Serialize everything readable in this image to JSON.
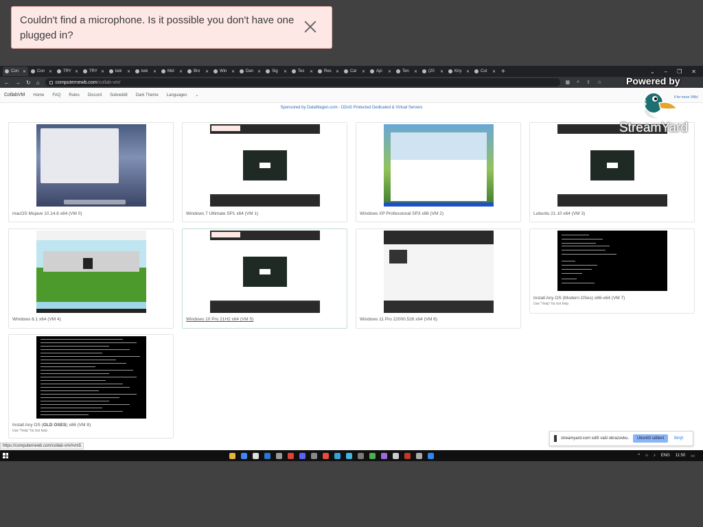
{
  "toast": {
    "message": "Couldn't find a microphone. Is it possible you don't have one plugged in?"
  },
  "browser": {
    "tabs": [
      {
        "label": "Con",
        "active": true
      },
      {
        "label": "Con"
      },
      {
        "label": "TRY"
      },
      {
        "label": "TRY"
      },
      {
        "label": "kek"
      },
      {
        "label": "kek"
      },
      {
        "label": "Mol"
      },
      {
        "label": "Bro"
      },
      {
        "label": "Win"
      },
      {
        "label": "Dan"
      },
      {
        "label": "Sig"
      },
      {
        "label": "Tes"
      },
      {
        "label": "Res"
      },
      {
        "label": "Cal"
      },
      {
        "label": "Api"
      },
      {
        "label": "Ten"
      },
      {
        "label": "(20"
      },
      {
        "label": "Kny"
      },
      {
        "label": "Cut"
      }
    ],
    "url_host": "computernewb.com",
    "url_path": "/collab-vm/",
    "status_url": "https://computernewb.com/collab-vm/#vm5"
  },
  "site_nav": {
    "brand": "CollabVM",
    "links": [
      "Home",
      "FAQ",
      "Rules",
      "Discord",
      "Subreddit",
      "Dark Theme",
      "Languages"
    ]
  },
  "sponsor_text": "Sponsored by DataWagon.com - DDoS Protected Dedicated & Virtual Servers",
  "vms": [
    {
      "label": "macOS Mojave 10.14.6 x64 (VM 0)"
    },
    {
      "label": "Windows 7 Ultimate SP1 x64 (VM 1)"
    },
    {
      "label": "Windows XP Professional SP3 x86 (VM 2)"
    },
    {
      "label": "Lubuntu 21.10 x64 (VM 3)"
    },
    {
      "label": "Windows 8.1 x64 (VM 4)"
    },
    {
      "label": "Windows 10 Pro 21H2 x64 (VM 5)"
    },
    {
      "label": "Windows 11 Pro 22000.526 x64 (VM 6)"
    },
    {
      "label": "Install Any OS (Modern OSes) x86-x64 (VM 7)",
      "hint": "Use \"!help\" for bot help"
    },
    {
      "label_prefix": "Install Any OS (",
      "label_bold": "OLD OSES",
      "label_suffix": ") x86 (VM 8)",
      "hint": "Use \"!help\" for bot help"
    }
  ],
  "overlay": {
    "powered_by": "Powered by",
    "brand": "StreamYard",
    "more_vms": "ll for more VMs!"
  },
  "share_bar": {
    "message": "streamyard.com sdílí vaši obrazovku.",
    "stop_label": "Ukončit sdílení",
    "hide_label": "Skrýt"
  },
  "taskbar": {
    "language": "ENG",
    "clock": "11:50"
  },
  "colors": {
    "background": "#414141",
    "toast_bg": "#fde8e6",
    "link": "#2a6bb8"
  }
}
